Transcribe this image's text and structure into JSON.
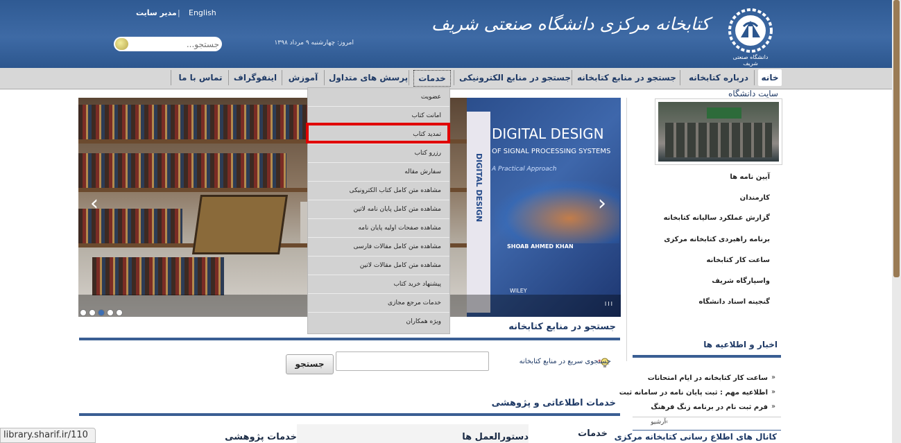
{
  "header": {
    "english_link": "English",
    "admin_link": "مدیر سایت",
    "separator": "|",
    "search_placeholder": "جستجو...",
    "date_text": "امروز: چهارشنبه ۹ مرداد ۱۳۹۸",
    "library_title": "کتابخانه مرکزی دانشگاه صنعتی شریف",
    "logo_caption": "دانشگاه صنعتی شریف"
  },
  "nav": {
    "home": "خانه",
    "about": "درباره کتابخانه",
    "search_library": "جستجو در منابع کتابخانه",
    "search_electronic": "جستجو در منابع الکترونیکی",
    "services": "خدمات",
    "faq": "پرسش های متداول",
    "education": "آموزش",
    "infographic": "اینفوگراف",
    "contact": "تماس با ما"
  },
  "dropdown": {
    "items": [
      "عضویت",
      "امانت کتاب",
      "تمدید کتاب",
      "رزرو کتاب",
      "سفارش مقاله",
      "مشاهده متن کامل کتاب الکترونیکی",
      "مشاهده متن کامل پایان نامه لاتین",
      "مشاهده صفحات اولیه پایان نامه",
      "مشاهده متن کامل مقالات فارسی",
      "مشاهده متن کامل مقالات لاتین",
      "پیشنهاد خرید کتاب",
      "خدمات مرجع مجازی",
      "ویژه همکاران"
    ]
  },
  "slider": {
    "book_title": "DIGITAL DESIGN",
    "book_subtitle": "OF SIGNAL PROCESSING SYSTEMS",
    "book_tagline": "A Practical Approach",
    "book_author": "SHOAB AHMED KHAN",
    "book_publisher": "WILEY",
    "spine_text": "DIGITAL DESIGN",
    "prev_arrow": "‹",
    "next_arrow": "›",
    "counter": "III",
    "dots_total": 5,
    "active_dot": 2
  },
  "search_section": {
    "title": "جستجو در منابع کتابخانه",
    "quick_label": "جستجوی سریع در منابع کتابخانه",
    "button": "جستجو",
    "input_value": ""
  },
  "info_services": {
    "title": "خدمات اطلاعاتی و پژوهشی",
    "col_services": "خدمات",
    "col_guidelines": "دستورالعمل ها",
    "col_research": "خدمات پژوهشی"
  },
  "sidebar": {
    "univ_site": "سایت دانشگاه",
    "links": [
      "آیین نامه ها",
      "کارمندان",
      "گزارش عملکرد سالیانه کتابخانه",
      "برنامه راهبردی کتابخانه مرکزی",
      "ساعت کار کتابخانه",
      "واسپارگاه شریف",
      "گنجینه اسناد دانشگاه"
    ],
    "news_title": "اخبار و اطلاعیه ها",
    "news": [
      "ساعت کار کتابخانه در ایام امتحانات",
      "اطلاعیه مهم : ثبت پایان نامه در سامانه ثبت",
      "فرم ثبت نام در برنامه زنگ فرهنگ"
    ],
    "archive": "آرشیو",
    "channels_title": "کانال های اطلاع رسانی کتابخانه مرکزی"
  },
  "status_bar": "library.sharif.ir/110",
  "colors": {
    "header_blue": "#3e6aa5",
    "nav_text": "#1f3a66",
    "highlight_red": "#e00000"
  }
}
